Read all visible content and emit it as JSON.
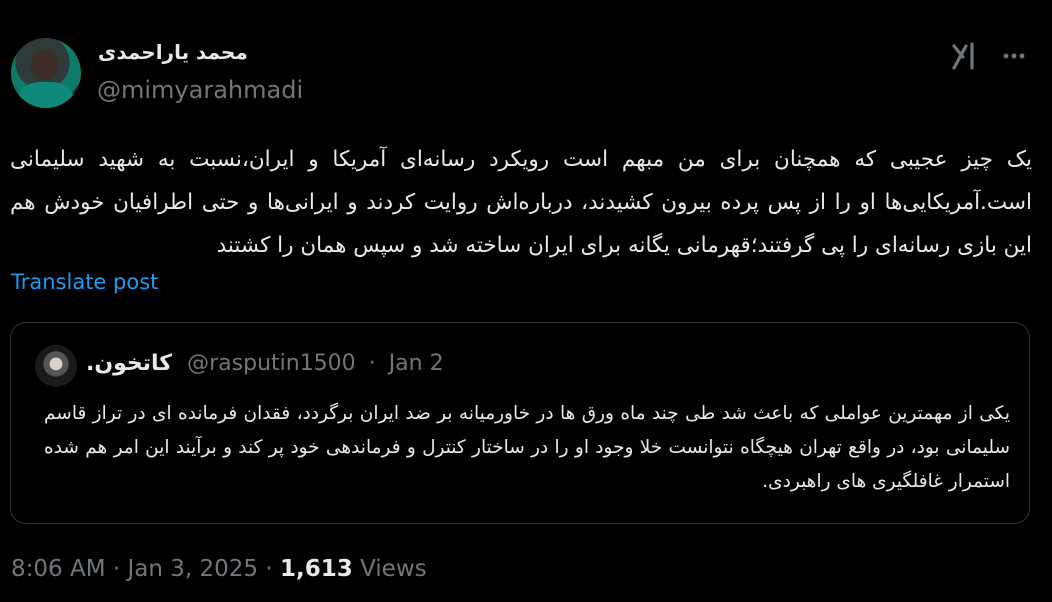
{
  "author": {
    "name": "محمد یاراحمدی",
    "handle": "@mimyarahmadi"
  },
  "tweet": {
    "text": "یک چیز عجیبی که همچنان برای من مبهم است رویکرد رسانه‌ای آمریکا و ایران،نسبت به شهید سلیمانی است.آمریکایی‌ها او را از پس پرده بیرون کشیدند، درباره‌اش روایت کردند و ایرانی‌ها و حتی اطرافیان خودش هم این بازی رسانه‌ای را پی گرفتند؛قهرمانی یگانه برای ایران ساخته شد و سپس همان را کشتند",
    "translate_label": "Translate post"
  },
  "quote": {
    "name": "کاتخون.",
    "handle": "@rasputin1500",
    "separator": "·",
    "date": "Jan 2",
    "text": "یکی از مهمترین عواملی که باعث شد طی چند ماه ورق ها در خاورمیانه بر ضد ایران برگردد، فقدان فرمانده ای در تراز قاسم سلیمانی بود، در واقع تهران هیچگاه نتوانست خلا وجود او را در ساختار کنترل و فرماندهی خود پر کند و برآیند این امر هم شده استمرار غافلگیری های راهبردی."
  },
  "meta": {
    "time": "8:06 AM",
    "sep1": "·",
    "date": "Jan 3, 2025",
    "sep2": "·",
    "views_count": "1,613",
    "views_label": "Views"
  },
  "icons": {
    "grok": "grok-icon",
    "more": "more-icon"
  },
  "colors": {
    "background": "#000000",
    "text": "#e7e9ea",
    "muted": "#71767b",
    "link": "#1d9bf0",
    "border": "#2f3336"
  }
}
